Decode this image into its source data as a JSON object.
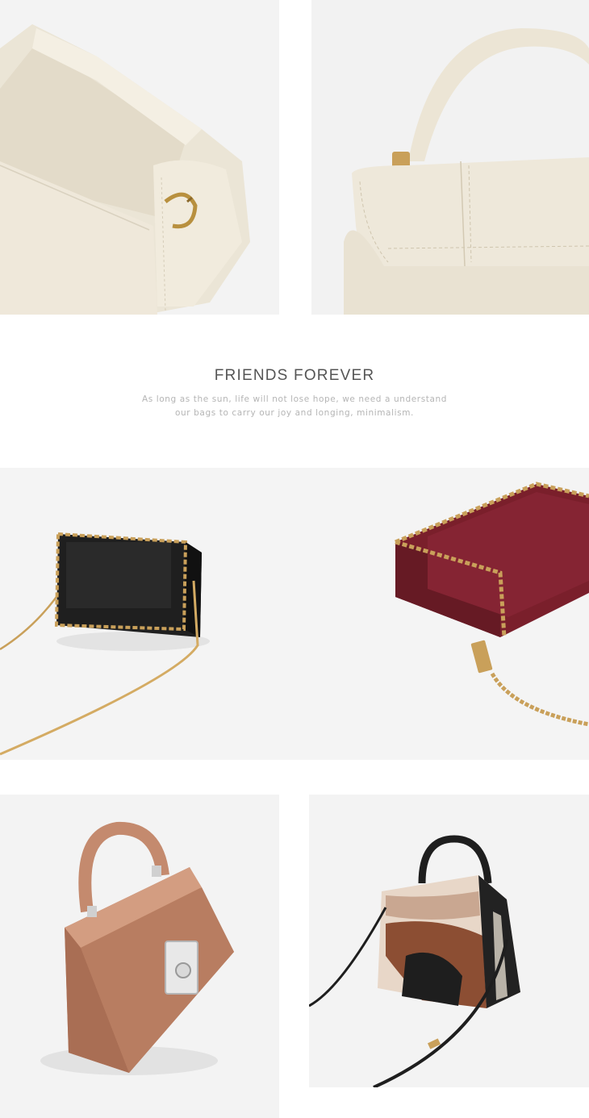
{
  "caption": {
    "title": "FRIENDS FOREVER",
    "line1": "As long as the sun, life will not lose hope, we need a understand",
    "line2": "our bags to carry our joy and longing, minimalism."
  },
  "colors": {
    "cream": "#ece6d8",
    "black_leather": "#1c1c1c",
    "burgundy": "#7a1f2b",
    "tan_croc": "#c48a6e",
    "gold": "#c9a05a"
  }
}
